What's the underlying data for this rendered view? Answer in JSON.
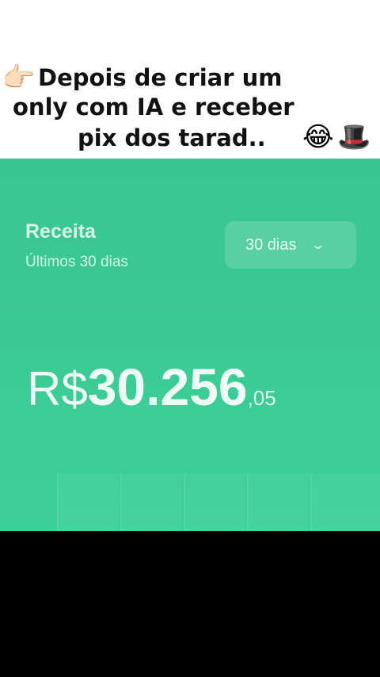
{
  "caption": {
    "line1": "Depois de criar um",
    "line2": "only com IA e receber",
    "line3": "pix dos tarad..",
    "emoji_point": "👉🏻",
    "emoji_laugh": "😂",
    "emoji_hat": "🎩"
  },
  "revenue_card": {
    "title": "Receita",
    "subtitle": "Últimos 30 dias",
    "range_value": "30 dias",
    "range_icon": "chevron-down-icon",
    "currency": "R$",
    "amount": "30.256",
    "cents": ",05",
    "background_color": "#3dcb94"
  }
}
